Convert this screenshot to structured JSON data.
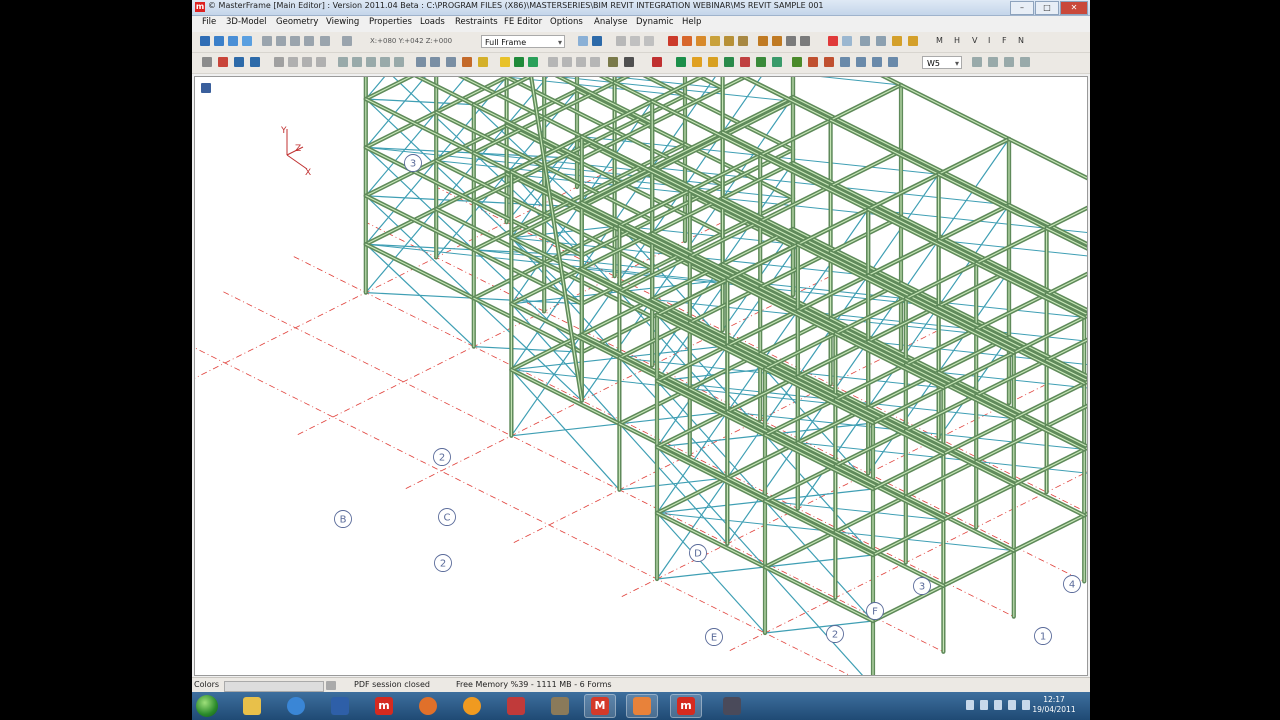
{
  "window": {
    "title": "© MasterFrame [Main Editor] : Version 2011.04 Beta : C:\\PROGRAM FILES (X86)\\MASTERSERIES\\BIM REVIT INTEGRATION WEBINAR\\MS REVIT SAMPLE 001"
  },
  "menu": [
    "File",
    "3D-Model",
    "Geometry",
    "Viewing",
    "Properties",
    "Loads",
    "Restraints",
    "FE Editor",
    "Options",
    "Analyse",
    "Dynamic",
    "Help"
  ],
  "toolbar": {
    "coords": "X:+080 Y:+042 Z:+000",
    "frame_select": "Full Frame",
    "weight_select": "W5",
    "right_letters": [
      "M",
      "H",
      "V",
      "I",
      "F",
      "N"
    ]
  },
  "viewport": {
    "axis_labels": {
      "x": "X",
      "y": "Y",
      "z": "Z"
    },
    "grid_labels": [
      "B",
      "C",
      "2",
      "D",
      "E",
      "2",
      "F",
      "3",
      "4",
      "1",
      "3",
      "2"
    ]
  },
  "statusbar": {
    "colors_label": "Colors",
    "pdf_status": "PDF session closed",
    "memory": "Free Memory %39 - 1111 MB - 6 Forms"
  },
  "taskbar": {
    "time": "12:17",
    "date": "19/04/2011"
  },
  "colors": {
    "steel": "#5f8a5a",
    "steel_highlight": "#c9e8b9",
    "bracing": "#3f9fb4",
    "gridline": "#e0403a",
    "grid_bubble": "#5a6b9a"
  }
}
